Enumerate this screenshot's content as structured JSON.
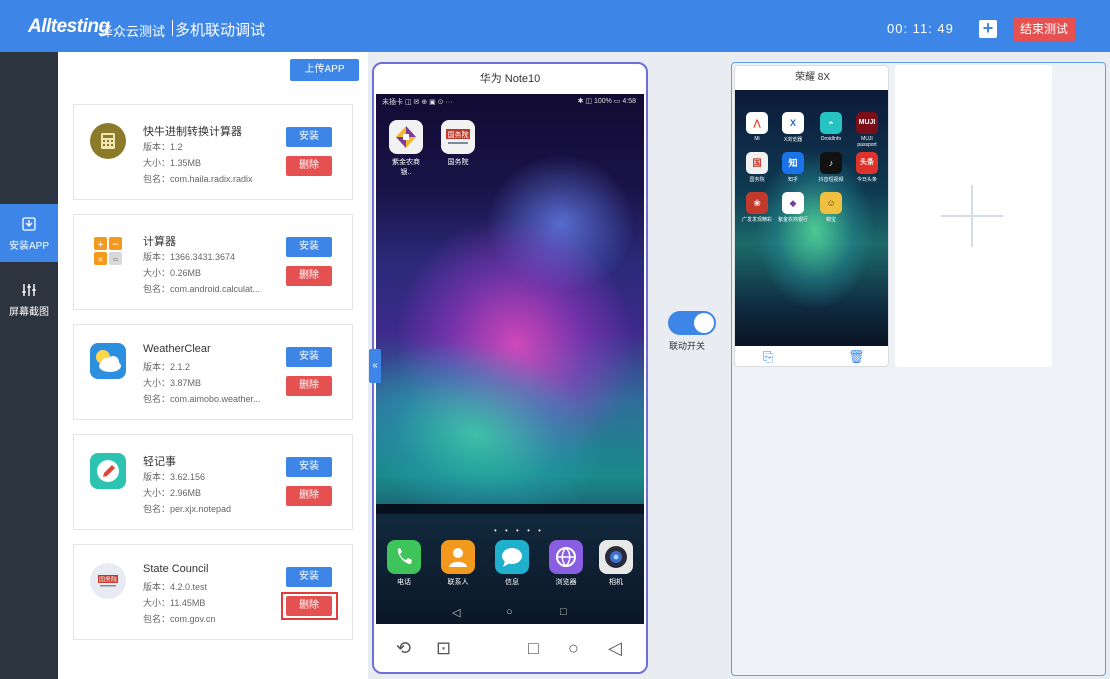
{
  "header": {
    "logo": "Alltesting",
    "logo_sub": "泽众云测试",
    "title": "多机联动调试",
    "timer": "00:  11:  49",
    "add_label": "+",
    "end_label": "结束测试"
  },
  "sidebar": {
    "items": [
      {
        "label": "安装APP",
        "icon": "install-icon",
        "active": true
      },
      {
        "label": "屏幕截图",
        "icon": "sliders-icon",
        "active": false
      }
    ]
  },
  "app_panel": {
    "upload_label": "上传APP",
    "install_label": "安装",
    "delete_label": "删除",
    "apps": [
      {
        "name": "快牛进制转换计算器",
        "version": "版本：1.2",
        "size": "大小：1.35MB",
        "package": "包名：com.haila.radix.radix",
        "icon_color": "#8a7a2a"
      },
      {
        "name": "计算器",
        "version": "版本：1366.3431.3674",
        "size": "大小：0.26MB",
        "package": "包名：com.android.calculat...",
        "icon_color": "#f39a1e"
      },
      {
        "name": "WeatherClear",
        "version": "版本：2.1.2",
        "size": "大小：3.87MB",
        "package": "包名：com.aimobo.weather...",
        "icon_color": "#2d8fe0"
      },
      {
        "name": "轻记事",
        "version": "版本：3.62.156",
        "size": "大小：2.96MB",
        "package": "包名：per.xjx.notepad",
        "icon_color": "#2cc4b0"
      },
      {
        "name": "State Council",
        "version": "版本：4.2.0.test",
        "size": "大小：11.45MB",
        "package": "包名：com.gov.cn",
        "icon_color": "#e8ecf2"
      }
    ]
  },
  "main_phone": {
    "title": "华为 Note10",
    "status_left": "未插卡 ◫ ✉ ⊕ ▣ ⊙ ···",
    "status_right": "✱ ◫ 100% ▭ 4:58",
    "home_icons": [
      {
        "label": "紫金农商银..",
        "color": "#f2f2f2",
        "glyph": "◆"
      },
      {
        "label": "国务院",
        "color": "#f2f2f2",
        "glyph": "国务院"
      }
    ],
    "dock": [
      {
        "label": "电话",
        "color": "#3fc35b",
        "glyph": "✆"
      },
      {
        "label": "联系人",
        "color": "#f39a1e",
        "glyph": "👤"
      },
      {
        "label": "信息",
        "color": "#1eb0cc",
        "glyph": "💬"
      },
      {
        "label": "浏览器",
        "color": "#8a5ee0",
        "glyph": "◎"
      },
      {
        "label": "相机",
        "color": "#e8e8e8",
        "glyph": "◉"
      }
    ],
    "nav_keys": [
      "◁",
      "○",
      "□"
    ],
    "toolbar": [
      "⟲",
      "⊡",
      "□",
      "○",
      "◁"
    ],
    "page_dots": "• • • • •"
  },
  "toggle": {
    "label": "联动开关",
    "on": true
  },
  "secondary_phone": {
    "title": "荣耀 8X",
    "icons_row1": [
      {
        "label": "Mi",
        "color": "#ffffff",
        "glyph": "⋀",
        "text_color": "#e5432e"
      },
      {
        "label": "X浏览器",
        "color": "#ffffff",
        "glyph": "X",
        "text_color": "#1c6dd0"
      },
      {
        "label": "DroidInfo",
        "color": "#27c2c2",
        "glyph": "◓",
        "text_color": "#ffffff"
      },
      {
        "label": "MUJI passport",
        "color": "#7a0f1a",
        "glyph": "MUJI",
        "text_color": "#ffffff"
      }
    ],
    "icons_row2": [
      {
        "label": "国务院",
        "color": "#f1f1f1",
        "glyph": "国",
        "text_color": "#c0392b"
      },
      {
        "label": "知乎",
        "color": "#1a73e8",
        "glyph": "知",
        "text_color": "#ffffff"
      },
      {
        "label": "抖音短视频",
        "color": "#111111",
        "glyph": "♪",
        "text_color": "#ffffff"
      },
      {
        "label": "今日头条",
        "color": "#e0312b",
        "glyph": "头条",
        "text_color": "#ffffff"
      }
    ],
    "icons_row3": [
      {
        "label": "广发发现精彩",
        "color": "#c0392b",
        "glyph": "❀",
        "text_color": "#ffffff"
      },
      {
        "label": "紫金农商银行",
        "color": "#ffffff",
        "glyph": "◆",
        "text_color": "#7a3aa0"
      },
      {
        "label": "萌宝",
        "color": "#f0c040",
        "glyph": "☺",
        "text_color": "#6a3b00"
      }
    ],
    "tools": [
      "⎘",
      "🗑"
    ]
  },
  "add_device": {
    "plus": "+"
  }
}
